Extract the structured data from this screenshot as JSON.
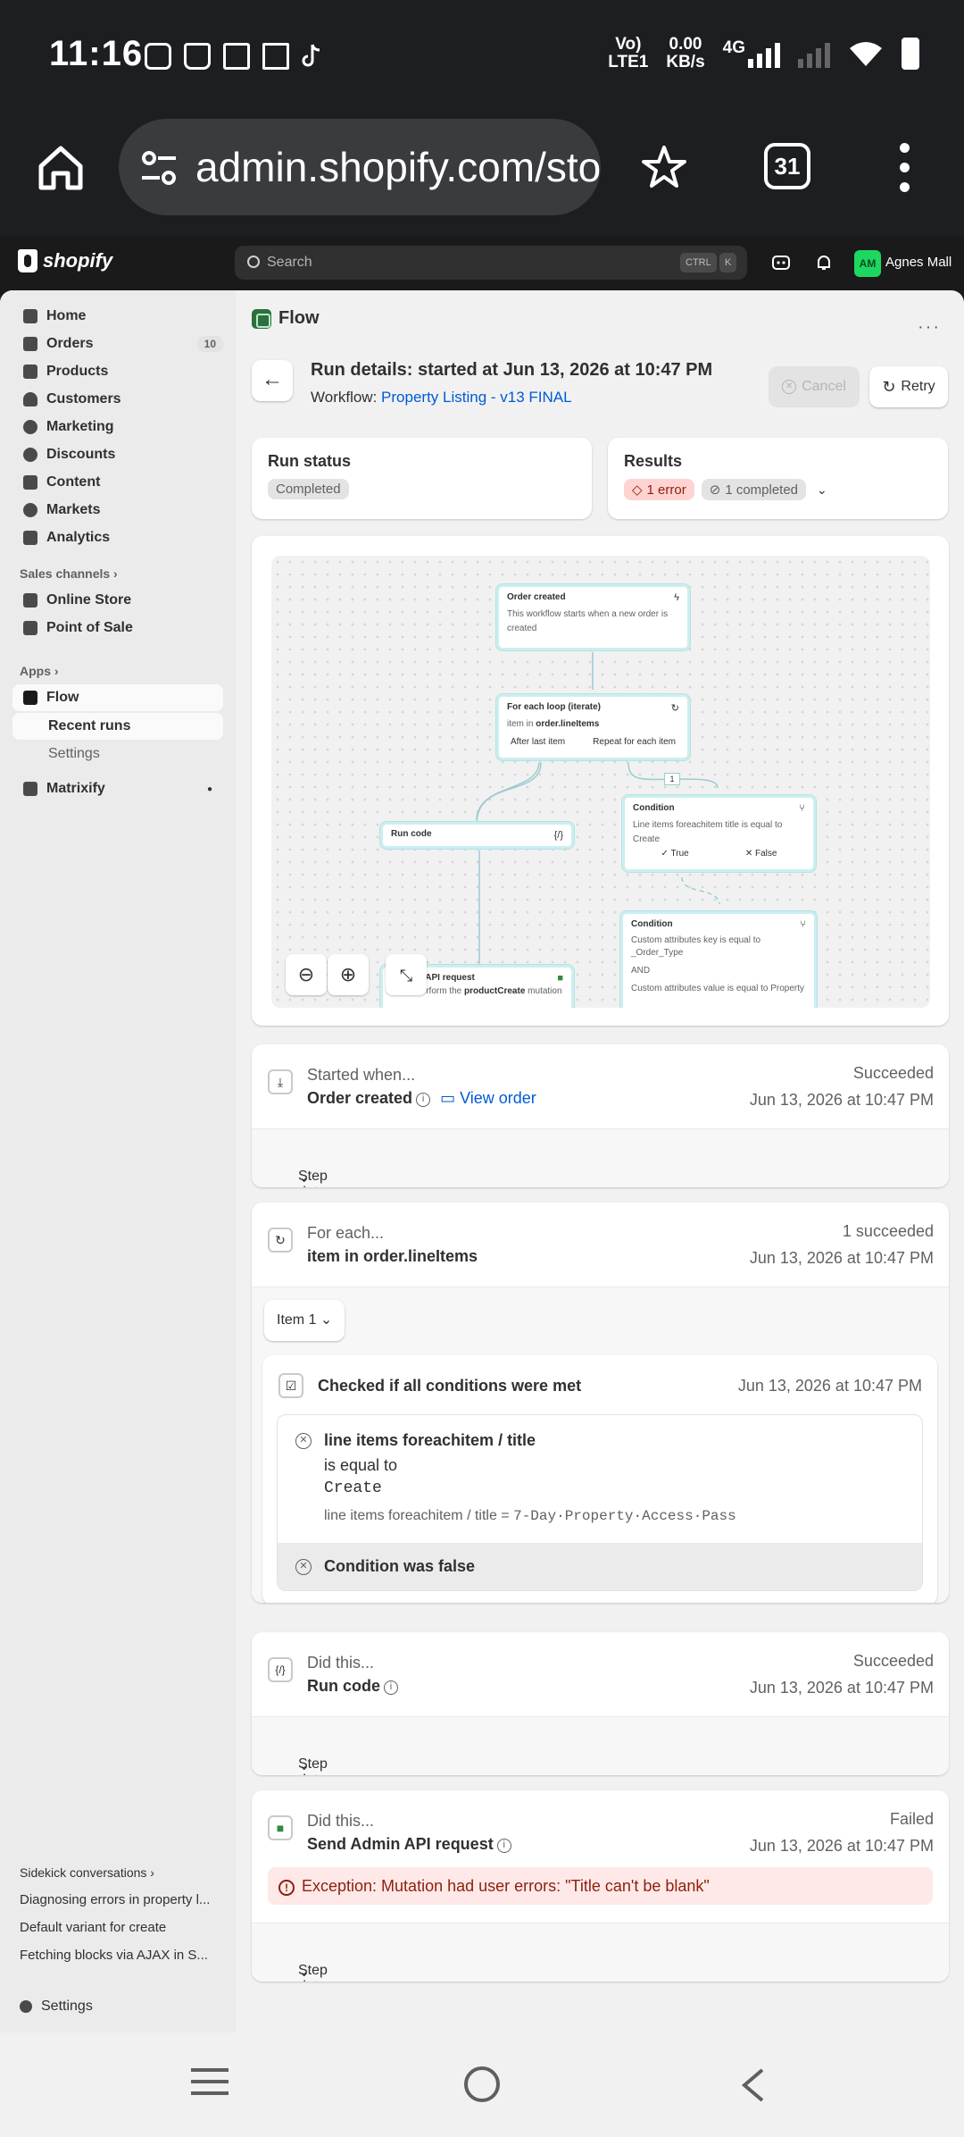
{
  "status_bar": {
    "time": "11:16",
    "net_label": "VoLTE1",
    "net_label_top": "Vo)",
    "net_label_bottom": "LTE1",
    "speed_value": "0.00",
    "speed_unit": "KB/s",
    "network_type": "4G"
  },
  "browser": {
    "url": "admin.shopify.com/sto",
    "tab_count": "31"
  },
  "topbar": {
    "brand": "shopify",
    "search_placeholder": "Search",
    "shortcut_key1": "CTRL",
    "shortcut_key2": "K",
    "avatar_initials": "AM",
    "user_name": "Agnes Mall"
  },
  "sidebar": {
    "items": [
      {
        "label": "Home",
        "icon": "home-icon"
      },
      {
        "label": "Orders",
        "icon": "orders-icon",
        "badge": "10"
      },
      {
        "label": "Products",
        "icon": "tag-icon"
      },
      {
        "label": "Customers",
        "icon": "person-icon"
      },
      {
        "label": "Marketing",
        "icon": "target-icon"
      },
      {
        "label": "Discounts",
        "icon": "discount-icon"
      },
      {
        "label": "Content",
        "icon": "content-icon"
      },
      {
        "label": "Markets",
        "icon": "globe-icon"
      },
      {
        "label": "Analytics",
        "icon": "chart-icon"
      }
    ],
    "sales_channels_label": "Sales channels",
    "sales_channels": [
      {
        "label": "Online Store",
        "icon": "store-icon"
      },
      {
        "label": "Point of Sale",
        "icon": "pos-icon"
      }
    ],
    "apps_label": "Apps",
    "flow_label": "Flow",
    "recent_runs_label": "Recent runs",
    "flow_settings_label": "Settings",
    "matrixify_label": "Matrixify",
    "sidekick_label": "Sidekick conversations",
    "sidekick_items": [
      "Diagnosing errors in property l...",
      "Default variant for create",
      "Fetching blocks via AJAX in S..."
    ],
    "settings_label": "Settings"
  },
  "page": {
    "app_title": "Flow",
    "more_label": "···",
    "run_title": "Run details: started at Jun 13, 2026 at 10:47 PM",
    "workflow_prefix": "Workflow:",
    "workflow_name": "Property Listing - v13 FINAL",
    "cancel_label": "Cancel",
    "retry_label": "Retry"
  },
  "run_status": {
    "title": "Run status",
    "value": "Completed"
  },
  "results": {
    "title": "Results",
    "errors": "1 error",
    "completed": "1 completed"
  },
  "diagram": {
    "order_created": {
      "title": "Order created",
      "body": "This workflow starts when a new order is created"
    },
    "for_each": {
      "title": "For each loop (iterate)",
      "body_prefix": "item in",
      "body_bold": "order.lineItems",
      "branch_left": "After last item",
      "branch_right": "Repeat for each item"
    },
    "run_code": {
      "title": "Run code",
      "corner": "{/}"
    },
    "api_request": {
      "title": "in API request",
      "body_prefix": "Perform the",
      "body_bold": "productCreate",
      "body_suffix": "mutation"
    },
    "condition1": {
      "title": "Condition",
      "body": "Line items foreachitem title is equal to Create",
      "true_label": "✓ True",
      "false_label": "✕ False"
    },
    "condition2": {
      "title": "Condition",
      "line1": "Custom attributes key is equal to _Order_Type",
      "line2": "AND",
      "line3": "Custom attributes value is equal to Property"
    },
    "edge_badge": "1"
  },
  "steps": {
    "started": {
      "label": "Started when...",
      "name": "Order created",
      "link": "View order",
      "status": "Succeeded",
      "date": "Jun 13, 2026 at 10:47 PM",
      "step_data": "Step data"
    },
    "foreach": {
      "label": "For each...",
      "name": "item in order.lineItems",
      "status": "1 succeeded",
      "date": "Jun 13, 2026 at 10:47 PM",
      "item_select": "Item 1"
    },
    "check": {
      "title": "Checked if all conditions were met",
      "date": "Jun 13, 2026 at 10:47 PM",
      "cond_field": "line items foreachitem / title",
      "cond_op": "is equal to",
      "cond_value": "Create",
      "actual_prefix": "line items foreachitem / title = ",
      "actual_value": "7-Day·Property·Access·Pass",
      "result": "Condition was false"
    },
    "run_code": {
      "label": "Did this...",
      "name": "Run code",
      "status": "Succeeded",
      "date": "Jun 13, 2026 at 10:47 PM",
      "step_data": "Step data"
    },
    "admin_api": {
      "label": "Did this...",
      "name": "Send Admin API request",
      "status": "Failed",
      "date": "Jun 13, 2026 at 10:47 PM",
      "error": "Exception: Mutation had user errors: \"Title can't be blank\"",
      "step_data": "Step data"
    }
  },
  "colors": {
    "accent_link": "#005bd3",
    "error_bg": "#fed3d1",
    "avatar": "#1ed760"
  }
}
